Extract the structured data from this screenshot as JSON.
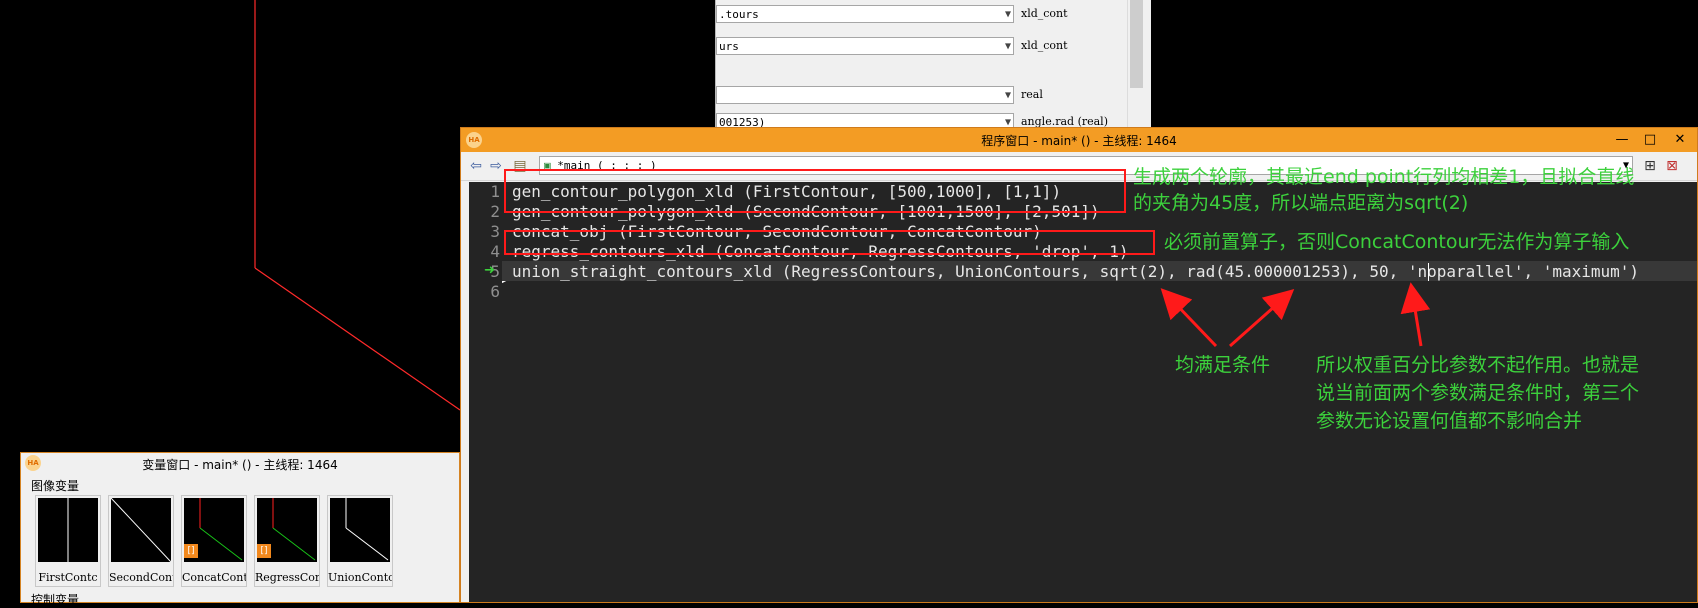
{
  "param_panel": {
    "rows": [
      {
        "value": ".tours",
        "type": "xld_cont"
      },
      {
        "value": "urs",
        "type": "xld_cont"
      },
      {
        "value": "",
        "type": "real"
      },
      {
        "value": "001253)",
        "type": "angle.rad (real)"
      }
    ]
  },
  "program_window": {
    "title": "程序窗口 - main* () - 主线程: 1464",
    "procedure": "*main ( : : : )",
    "line_numbers": [
      "1",
      "2",
      "3",
      "4",
      "5",
      "6"
    ],
    "lines": [
      "gen_contour_polygon_xld (FirstContour, [500,1000], [1,1])",
      "gen_contour_polygon_xld (SecondContour, [1001,1500], [2,501])",
      "concat_obj (FirstContour, SecondContour, ConcatContour)",
      "regress_contours_xld (ConcatContour, RegressContours, 'drop', 1)",
      "union_straight_contours_xld (RegressContours, UnionContours, sqrt(2), rad(45.000001253), 50, 'noparallel', 'maximum')",
      ""
    ]
  },
  "annotations": {
    "note1_line1": "生成两个轮廓，其最近end point行列均相差1，且拟合直线",
    "note1_line2": "的夹角为45度，所以端点距离为sqrt(2)",
    "note2": "必须前置算子，否则ConcatContour无法作为算子输入",
    "note3": "均满足条件",
    "note4_line1": "所以权重百分比参数不起作用。也就是",
    "note4_line2": "说当前面两个参数满足条件时，第三个",
    "note4_line3": "参数无论设置何值都不影响合并"
  },
  "variable_window": {
    "title": "变量窗口 - main* () - 主线程: 1464",
    "group_label": "图像变量",
    "group2_label": "控制变量",
    "thumbnails": [
      {
        "label": "FirstContc"
      },
      {
        "label": "SecondCont"
      },
      {
        "label": "ConcatCont"
      },
      {
        "label": "RegressCor"
      },
      {
        "label": "UnionContc"
      }
    ]
  },
  "icons": [
    "app-logo-icon",
    "back-arrow-icon",
    "forward-arrow-icon",
    "insert-procedure-icon",
    "procedure-icon",
    "dropdown-icon",
    "minimize-icon",
    "maximize-icon",
    "close-icon",
    "execution-arrow-icon"
  ],
  "colors": {
    "title_bar": "#f39c24",
    "editor_bg": "#242424",
    "annotation_green": "#3cd13c",
    "annotation_red": "#ff1a1a"
  }
}
